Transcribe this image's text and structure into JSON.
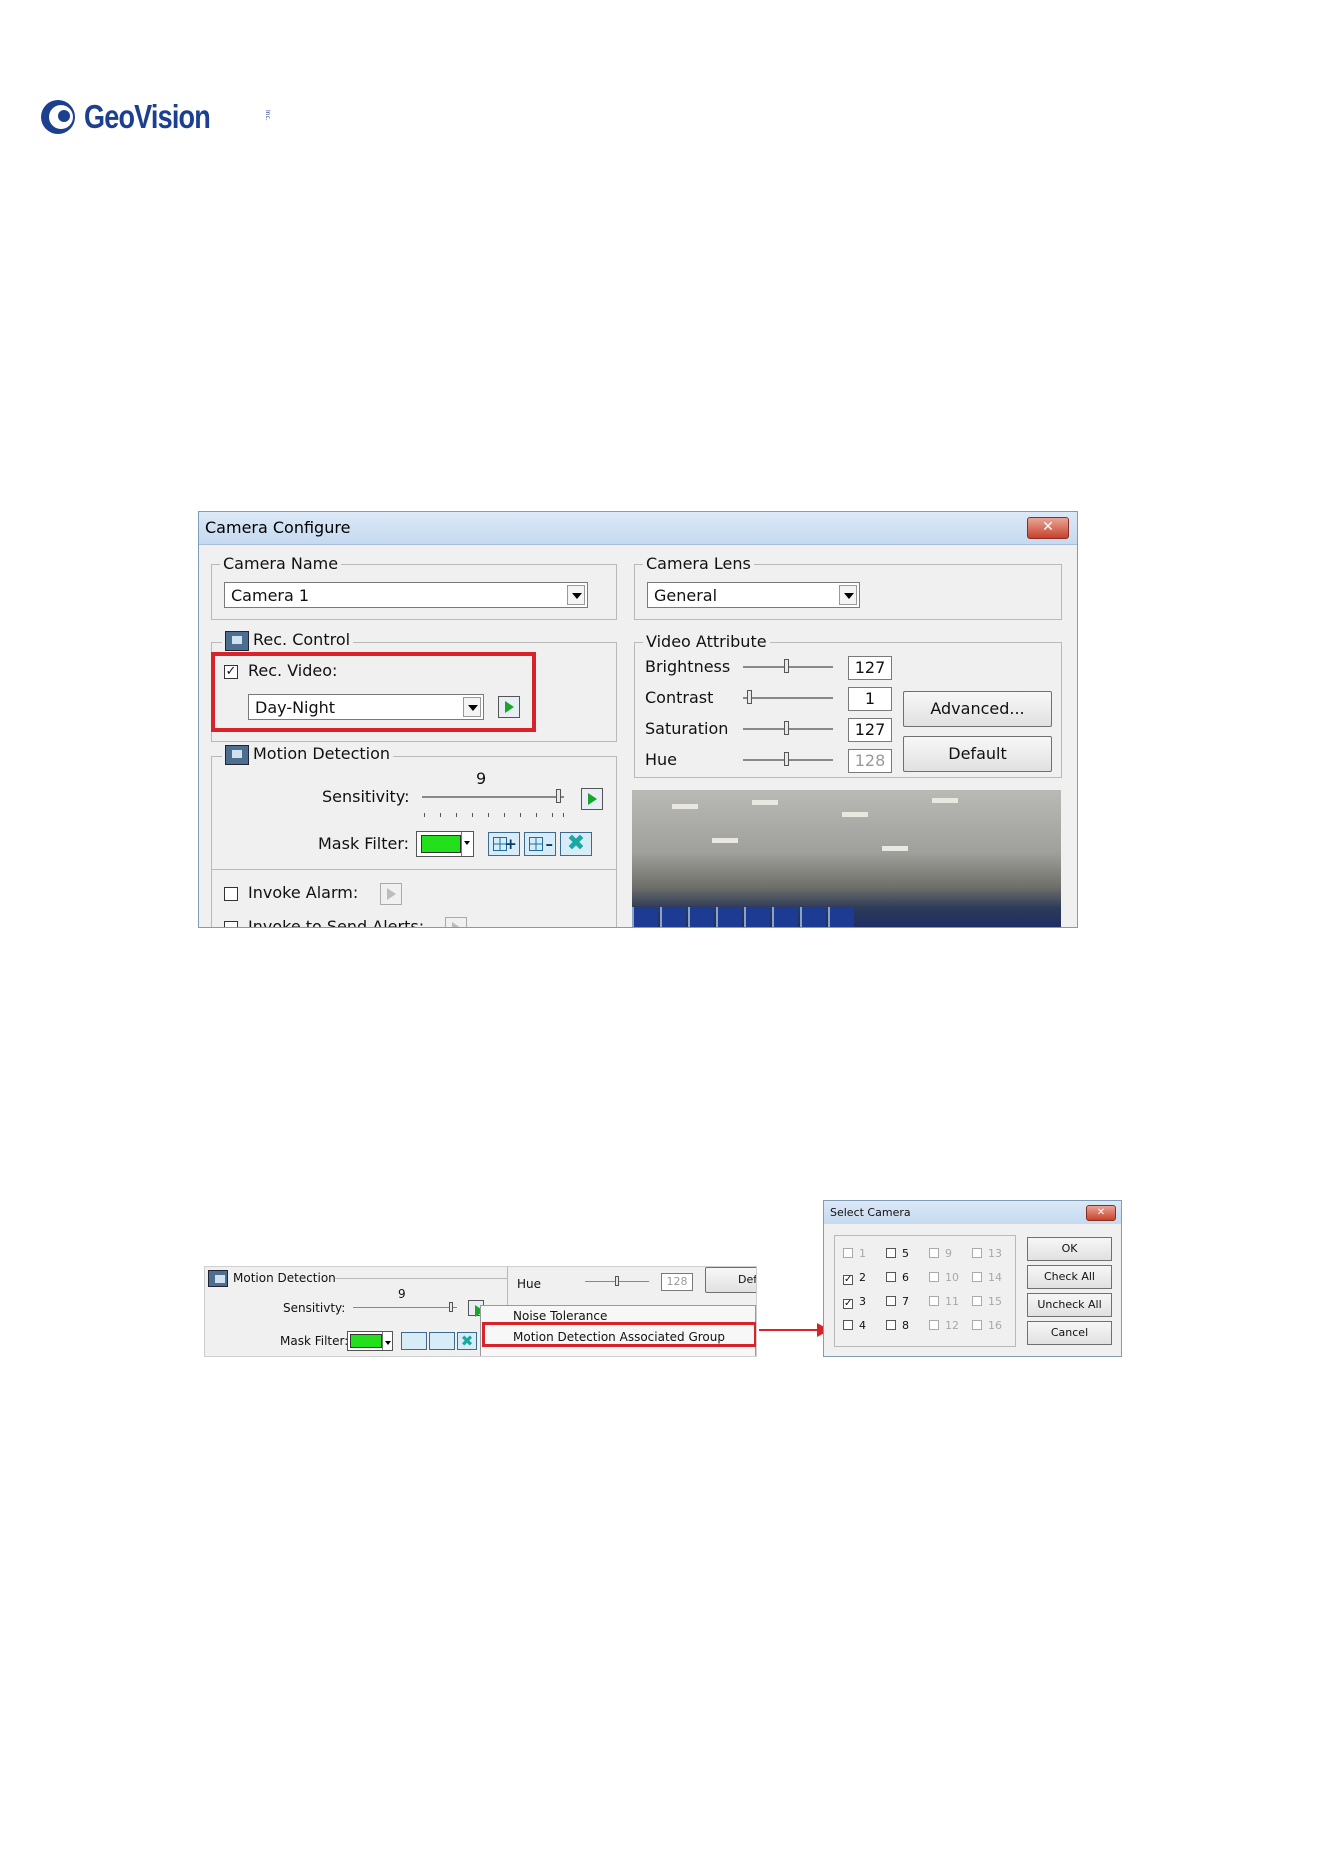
{
  "brand": {
    "name": "GeoVision",
    "suffix": "Inc."
  },
  "camera_configure": {
    "title": "Camera Configure",
    "camera_name": {
      "legend": "Camera Name",
      "value": "Camera 1"
    },
    "camera_lens": {
      "legend": "Camera Lens",
      "value": "General"
    },
    "rec_control": {
      "legend": "Rec. Control",
      "rec_video_label": "Rec. Video:",
      "rec_video_checked": true,
      "mode": "Day-Night"
    },
    "motion_detection": {
      "legend": "Motion Detection",
      "sensitivity_label": "Sensitivity:",
      "sensitivity_value": "9",
      "mask_filter_label": "Mask Filter:",
      "mask_color": "#22e01c"
    },
    "invoke_alarm_label": "Invoke Alarm:",
    "invoke_alerts_label": "Invoke to Send Alerts:",
    "video_attribute": {
      "legend": "Video Attribute",
      "rows": [
        {
          "label": "Brightness",
          "value": "127",
          "level": 0.5
        },
        {
          "label": "Contrast",
          "value": "1",
          "level": 0.0
        },
        {
          "label": "Saturation",
          "value": "127",
          "level": 0.5
        },
        {
          "label": "Hue",
          "value": "128",
          "level": 0.5
        }
      ],
      "advanced_label": "Advanced...",
      "default_label": "Default"
    }
  },
  "detail": {
    "motion_detection_label": "Motion Detection",
    "sensitivity_label": "Sensitivty:",
    "sensitivity_value": "9",
    "mask_filter_label": "Mask Filter:",
    "hue_label": "Hue",
    "hue_value": "128",
    "default_partial": "Defa",
    "menu": [
      "Noise Tolerance",
      "Motion Detection Associated Group"
    ]
  },
  "select_camera": {
    "title": "Select Camera",
    "cameras": [
      {
        "n": "1",
        "checked": false,
        "enabled": false
      },
      {
        "n": "5",
        "checked": false,
        "enabled": true
      },
      {
        "n": "9",
        "checked": false,
        "enabled": false
      },
      {
        "n": "13",
        "checked": false,
        "enabled": false
      },
      {
        "n": "2",
        "checked": true,
        "enabled": true
      },
      {
        "n": "6",
        "checked": false,
        "enabled": true
      },
      {
        "n": "10",
        "checked": false,
        "enabled": false
      },
      {
        "n": "14",
        "checked": false,
        "enabled": false
      },
      {
        "n": "3",
        "checked": true,
        "enabled": true
      },
      {
        "n": "7",
        "checked": false,
        "enabled": true
      },
      {
        "n": "11",
        "checked": false,
        "enabled": false
      },
      {
        "n": "15",
        "checked": false,
        "enabled": false
      },
      {
        "n": "4",
        "checked": false,
        "enabled": true
      },
      {
        "n": "8",
        "checked": false,
        "enabled": true
      },
      {
        "n": "12",
        "checked": false,
        "enabled": false
      },
      {
        "n": "16",
        "checked": false,
        "enabled": false
      }
    ],
    "buttons": [
      "OK",
      "Check All",
      "Uncheck All",
      "Cancel"
    ]
  }
}
